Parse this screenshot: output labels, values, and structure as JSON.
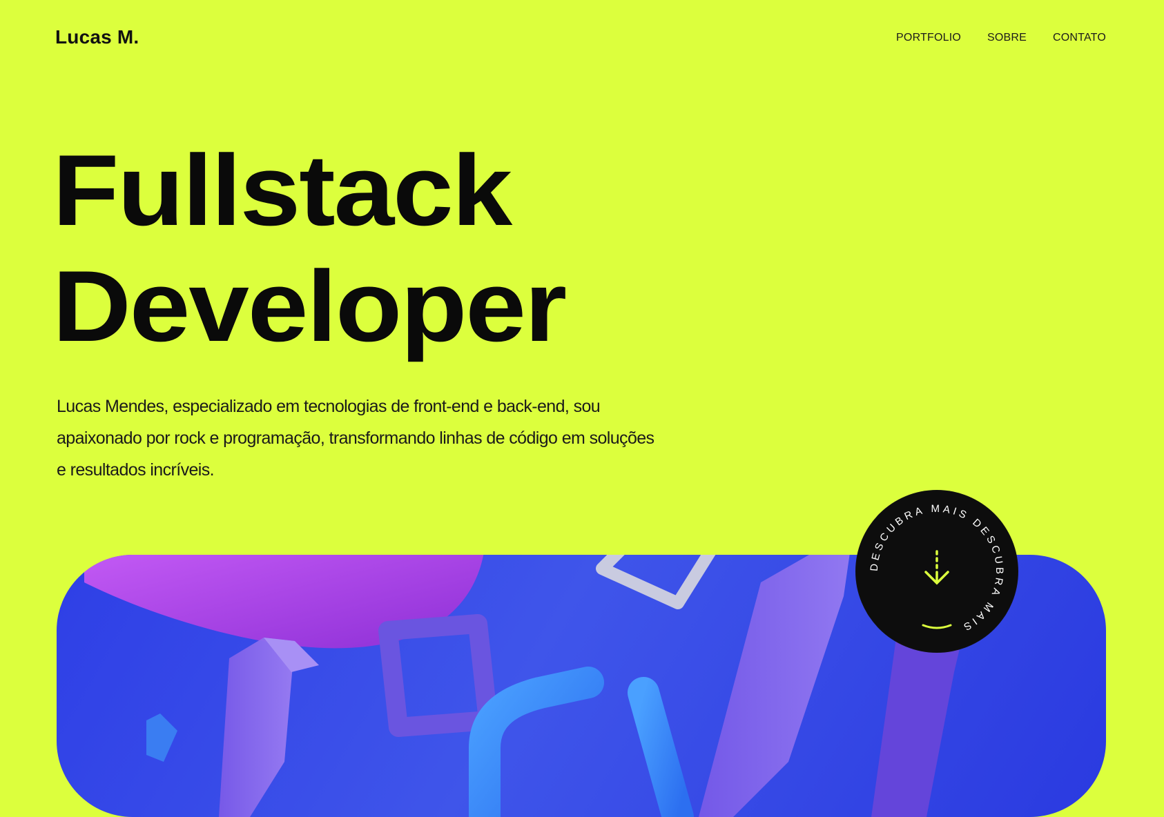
{
  "brand": {
    "name": "Lucas M."
  },
  "nav": {
    "items": [
      {
        "label": "PORTFOLIO"
      },
      {
        "label": "SOBRE"
      },
      {
        "label": "CONTATO"
      }
    ]
  },
  "hero": {
    "title_line1": "Fullstack",
    "title_line2": "Developer",
    "description": "Lucas Mendes,  especializado em tecnologias de front-end e back-end, sou apaixonado por rock e programação, transformando linhas de código em soluções e resultados incríveis."
  },
  "discover": {
    "ring_text": "DESCUBRA MAIS   DESCUBRA MAIS   ",
    "icon": "arrow-down-icon"
  },
  "colors": {
    "background": "#dcff3d",
    "text": "#0b0b0b",
    "badge": "#0d0d0d",
    "accent": "#dcff3d",
    "art_blue": "#2e3fe6",
    "art_purple": "#b552f0"
  }
}
